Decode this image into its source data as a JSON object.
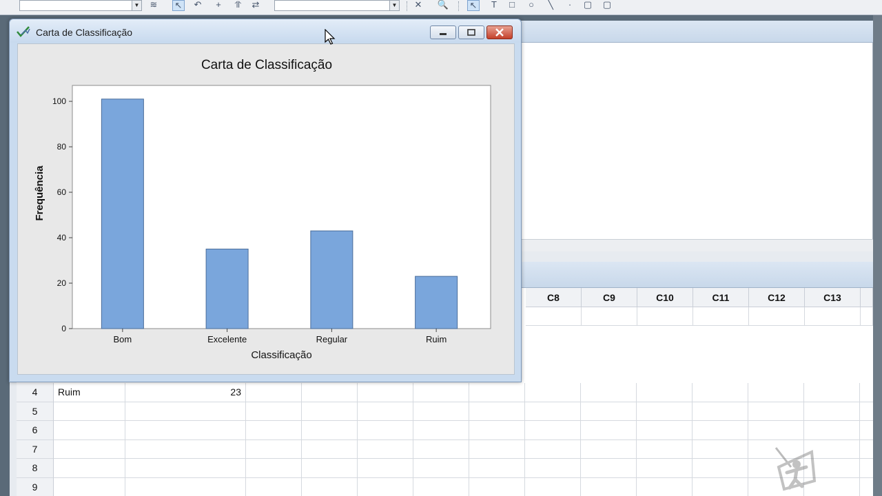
{
  "window": {
    "title": "Carta de Classificação"
  },
  "worksheet": {
    "columns": [
      "C8",
      "C9",
      "C10",
      "C11",
      "C12",
      "C13"
    ],
    "rows": [
      {
        "num": "4",
        "name": "Ruim",
        "value": "23"
      },
      {
        "num": "5",
        "name": "",
        "value": ""
      },
      {
        "num": "6",
        "name": "",
        "value": ""
      },
      {
        "num": "7",
        "name": "",
        "value": ""
      },
      {
        "num": "8",
        "name": "",
        "value": ""
      },
      {
        "num": "9",
        "name": "",
        "value": ""
      }
    ]
  },
  "chart_data": {
    "type": "bar",
    "title": "Carta de Classificação",
    "xlabel": "Classificação",
    "ylabel": "Frequência",
    "categories": [
      "Bom",
      "Excelente",
      "Regular",
      "Ruim"
    ],
    "values": [
      101,
      35,
      43,
      23
    ],
    "ylim": [
      0,
      107
    ],
    "yticks": [
      0,
      20,
      40,
      60,
      80,
      100
    ],
    "bar_color": "#7aa6dc",
    "grid": false
  },
  "colors": {
    "bar": "#7aa6dc",
    "bar_border": "#4a6d9a"
  }
}
